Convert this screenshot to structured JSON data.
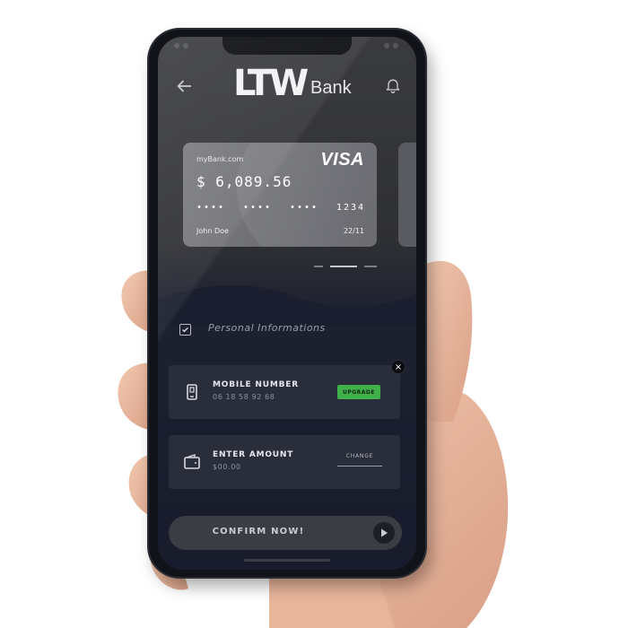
{
  "app": {
    "logo_mark": "LTW",
    "logo_word": "Bank"
  },
  "card": {
    "site": "myBank.com",
    "brand": "VISA",
    "balance": "$ 6,089.56",
    "number_groups": [
      "••••",
      "••••",
      "••••",
      "1234"
    ],
    "holder": "John Doe",
    "expiry": "22/11"
  },
  "form": {
    "section_label": "Personal Informations",
    "mobile": {
      "title": "MOBILE NUMBER",
      "value": "06 18 58 92 68",
      "action": "UPGRADE"
    },
    "amount": {
      "title": "ENTER AMOUNT",
      "value": "$00.00",
      "action": "CHANGE"
    },
    "close_glyph": "×",
    "confirm_label": "CONFIRM NOW!"
  },
  "icons": {
    "back": "back-arrow-icon",
    "bell": "bell-icon",
    "phone": "mobile-phone-icon",
    "wallet": "wallet-icon",
    "check": "checkbox-icon",
    "arrow": "play-arrow-icon"
  },
  "colors": {
    "accent_green": "#3fb04a",
    "panel": "#2a2e3b",
    "background_dark": "#171b2b"
  }
}
